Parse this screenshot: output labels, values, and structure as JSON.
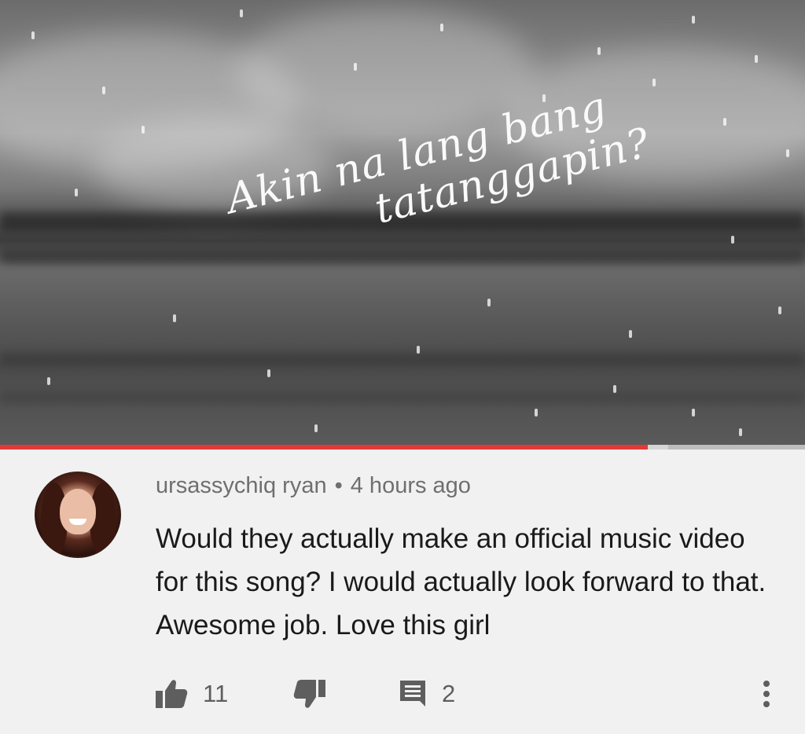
{
  "video": {
    "lyric_line1": "Akin na lang bang",
    "lyric_line2": "tatanggapin?",
    "progress_fraction": 0.805,
    "buffer_fraction": 0.83,
    "progress_color": "#e53935"
  },
  "comment": {
    "author": "ursassychiq ryan",
    "separator": "•",
    "time": "4 hours ago",
    "text": "Would they actually make an official music video for this song? I would actually look forward to that. Awesome job. Love this girl",
    "likes": "11",
    "replies": "2",
    "icons": {
      "like": "thumbs-up-icon",
      "dislike": "thumbs-down-icon",
      "reply": "comment-icon",
      "more": "more-vertical-icon"
    }
  }
}
